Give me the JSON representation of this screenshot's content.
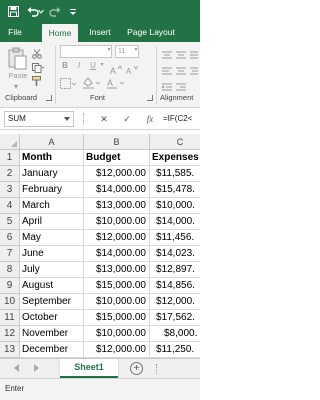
{
  "titlebar": {
    "save_icon": "save-icon",
    "undo_icon": "undo-icon",
    "redo_icon": "redo-icon"
  },
  "ribbon_tabs": [
    "File",
    "Home",
    "Insert",
    "Page Layout"
  ],
  "active_tab": "Home",
  "ribbon": {
    "paste_label": "Paste",
    "font_size": "11",
    "font_buttons": [
      "B",
      "I",
      "U"
    ],
    "groups": [
      "Clipboard",
      "Font",
      "Alignment"
    ]
  },
  "formula_bar": {
    "name_box": "SUM",
    "cancel_symbol": "✕",
    "enter_symbol": "✓",
    "fx_label": "fx",
    "formula": "=IF(C2<"
  },
  "columns": [
    "A",
    "B",
    "C"
  ],
  "header_row": {
    "num": "1",
    "a": "Month",
    "b": "Budget",
    "c": "Expenses"
  },
  "rows": [
    {
      "num": "2",
      "a": "January",
      "b": "$12,000.00",
      "c": "$11,585."
    },
    {
      "num": "3",
      "a": "February",
      "b": "$14,000.00",
      "c": "$15,478."
    },
    {
      "num": "4",
      "a": "March",
      "b": "$13,000.00",
      "c": "$10,000."
    },
    {
      "num": "5",
      "a": "April",
      "b": "$10,000.00",
      "c": "$14,000."
    },
    {
      "num": "6",
      "a": "May",
      "b": "$12,000.00",
      "c": "$11,456."
    },
    {
      "num": "7",
      "a": "June",
      "b": "$14,000.00",
      "c": "$14,023."
    },
    {
      "num": "8",
      "a": "July",
      "b": "$13,000.00",
      "c": "$12,897."
    },
    {
      "num": "9",
      "a": "August",
      "b": "$15,000.00",
      "c": "$14,856."
    },
    {
      "num": "10",
      "a": "September",
      "b": "$10,000.00",
      "c": "$12,000."
    },
    {
      "num": "11",
      "a": "October",
      "b": "$15,000.00",
      "c": "$17,562."
    },
    {
      "num": "12",
      "a": "November",
      "b": "$10,000.00",
      "c": "$8,000."
    },
    {
      "num": "13",
      "a": "December",
      "b": "$12,000.00",
      "c": "$11,250."
    }
  ],
  "sheet_tabs": [
    "Sheet1"
  ],
  "status": "Enter",
  "colors": {
    "accent": "#217346",
    "ribbon_bg": "#f3f3f3",
    "header_bg": "#efefef"
  }
}
